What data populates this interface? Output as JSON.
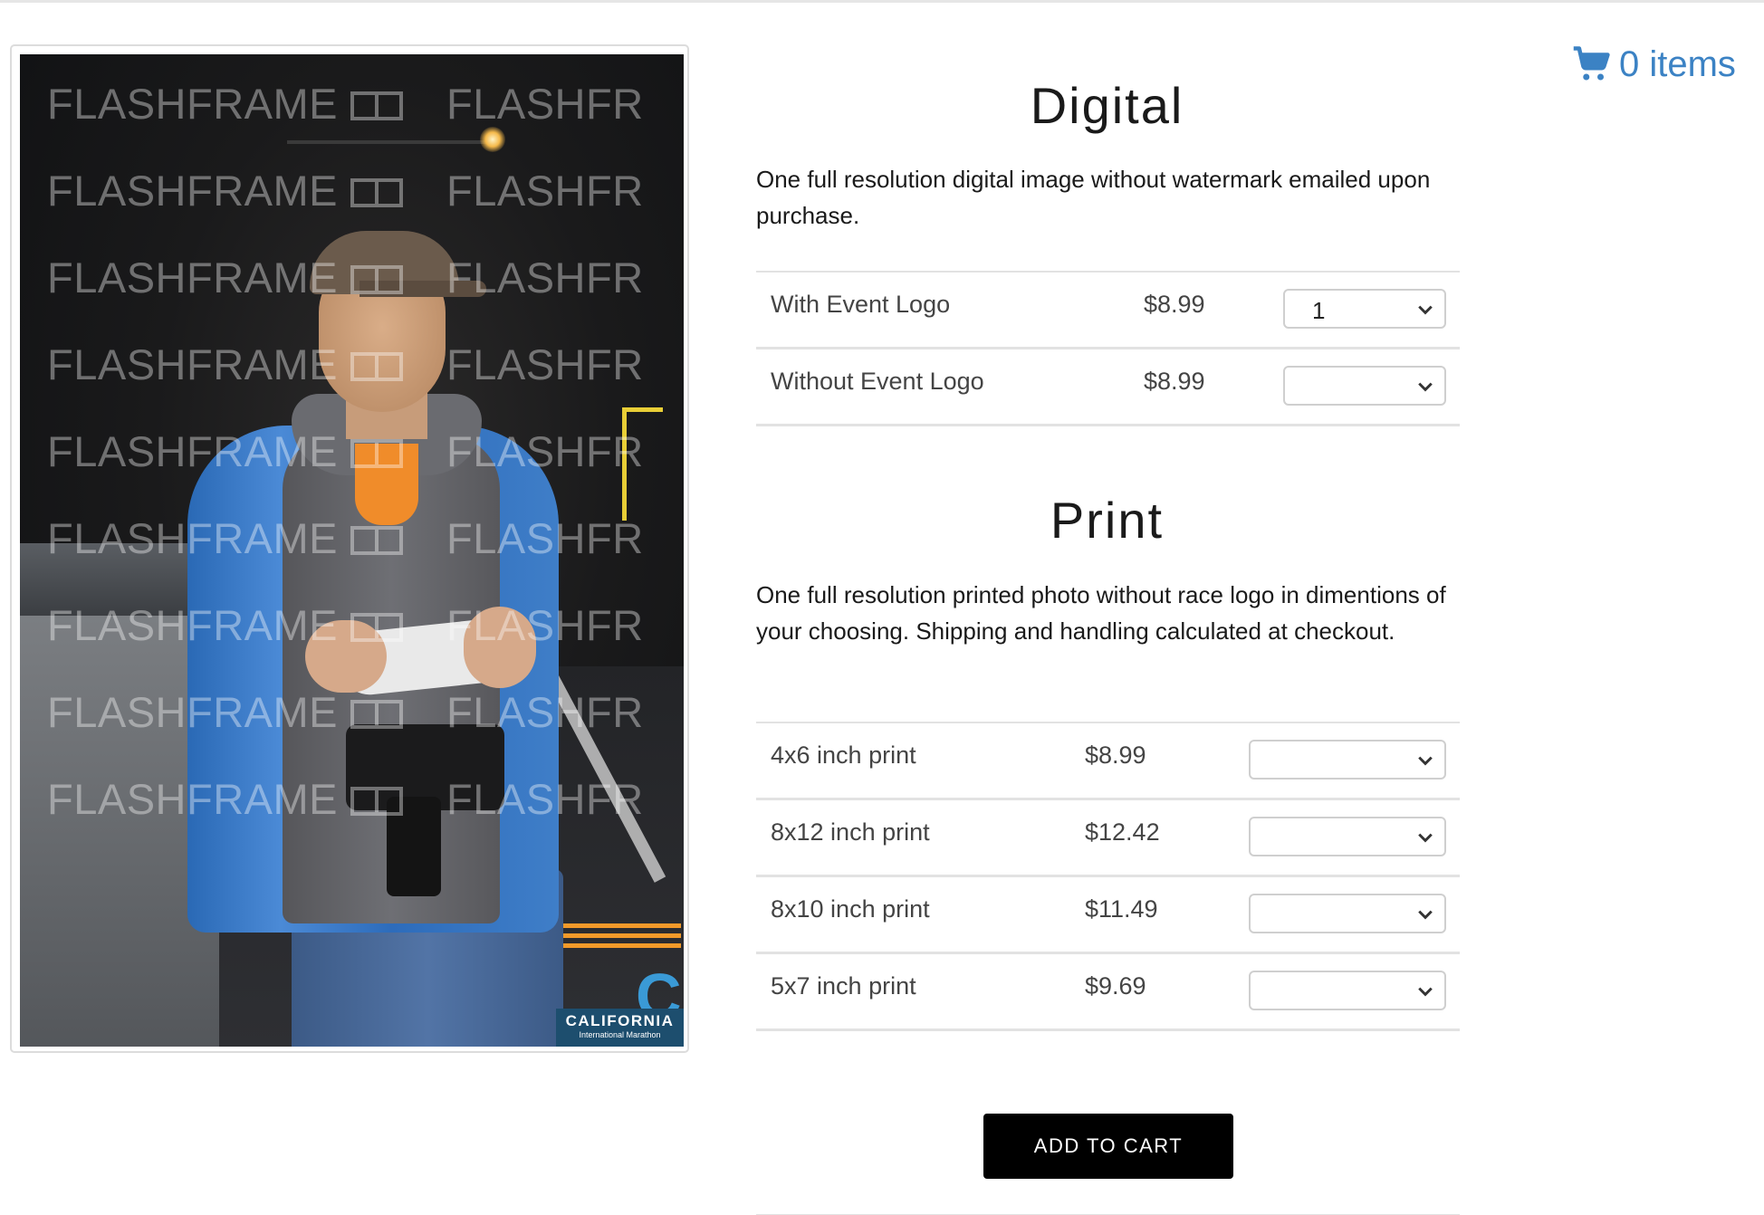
{
  "cart": {
    "label": "0 items"
  },
  "photo": {
    "watermark_text": "FLASHFRAME",
    "watermark_partial": "FLASHFR",
    "sponsor_logo_line1": "CALIFORNIA",
    "sponsor_logo_line2": "International Marathon",
    "sponsor_letters": "CIM"
  },
  "digital": {
    "title": "Digital",
    "description": "One full resolution digital image without watermark emailed upon purchase.",
    "items": [
      {
        "name": "With Event Logo",
        "price": "$8.99",
        "qty": "1"
      },
      {
        "name": "Without Event Logo",
        "price": "$8.99",
        "qty": ""
      }
    ]
  },
  "print": {
    "title": "Print",
    "description": "One full resolution printed photo without race logo in dimentions of your choosing. Shipping and handling calculated at checkout.",
    "items": [
      {
        "name": "4x6 inch print",
        "price": "$8.99",
        "qty": ""
      },
      {
        "name": "8x12 inch print",
        "price": "$12.42",
        "qty": ""
      },
      {
        "name": "8x10 inch print",
        "price": "$11.49",
        "qty": ""
      },
      {
        "name": "5x7 inch print",
        "price": "$9.69",
        "qty": ""
      }
    ]
  },
  "actions": {
    "add_to_cart": "ADD TO CART"
  },
  "colors": {
    "link": "#3b82c4",
    "button": "#000000",
    "divider": "#e2e2e2"
  }
}
